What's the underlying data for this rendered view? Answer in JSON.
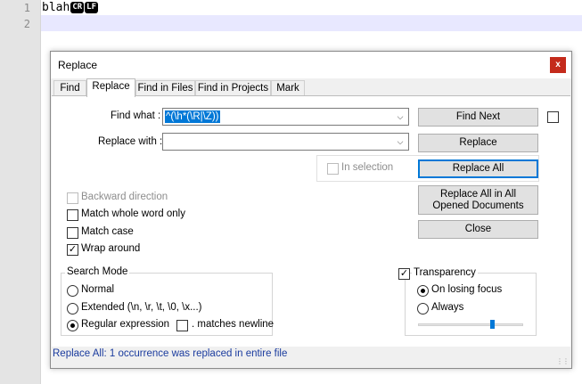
{
  "editor": {
    "line_numbers": [
      "1",
      "2"
    ],
    "line1_text": "blah",
    "eol_markers": [
      "CR",
      "LF"
    ]
  },
  "dialog": {
    "title": "Replace",
    "close_glyph": "x",
    "tabs": [
      "Find",
      "Replace",
      "Find in Files",
      "Find in Projects",
      "Mark"
    ],
    "active_tab": "Replace",
    "find_what_label": "Find what :",
    "find_what_value": "^(\\h*(\\R|\\Z))",
    "replace_with_label": "Replace with :",
    "replace_with_value": "",
    "combo_arrow_icon": "chevron-down-icon",
    "buttons": {
      "find_next": "Find Next",
      "replace": "Replace",
      "replace_all": "Replace All",
      "replace_all_opened": "Replace All in All Opened Documents",
      "close": "Close"
    },
    "in_selection_label": "In selection",
    "options": {
      "backward": {
        "label": "Backward direction",
        "checked": false,
        "enabled": false
      },
      "whole_word": {
        "label": "Match whole word only",
        "checked": false
      },
      "match_case": {
        "label": "Match case",
        "checked": false
      },
      "wrap_around": {
        "label": "Wrap around",
        "checked": true
      }
    },
    "search_mode": {
      "title": "Search Mode",
      "normal": "Normal",
      "extended": "Extended (\\n, \\r, \\t, \\0, \\x...)",
      "regex": "Regular expression",
      "selected": "regex",
      "matches_newline": ". matches newline",
      "matches_newline_checked": false
    },
    "transparency": {
      "label": "Transparency",
      "checked": true,
      "on_losing_focus": "On losing focus",
      "always": "Always",
      "selected": "on_losing_focus",
      "level": 0.7
    },
    "status_message": "Replace All: 1 occurrence was replaced in entire file",
    "accent_color": "#0078d7",
    "status_color": "#1a3b9e",
    "close_button_color": "#c42b1c"
  }
}
